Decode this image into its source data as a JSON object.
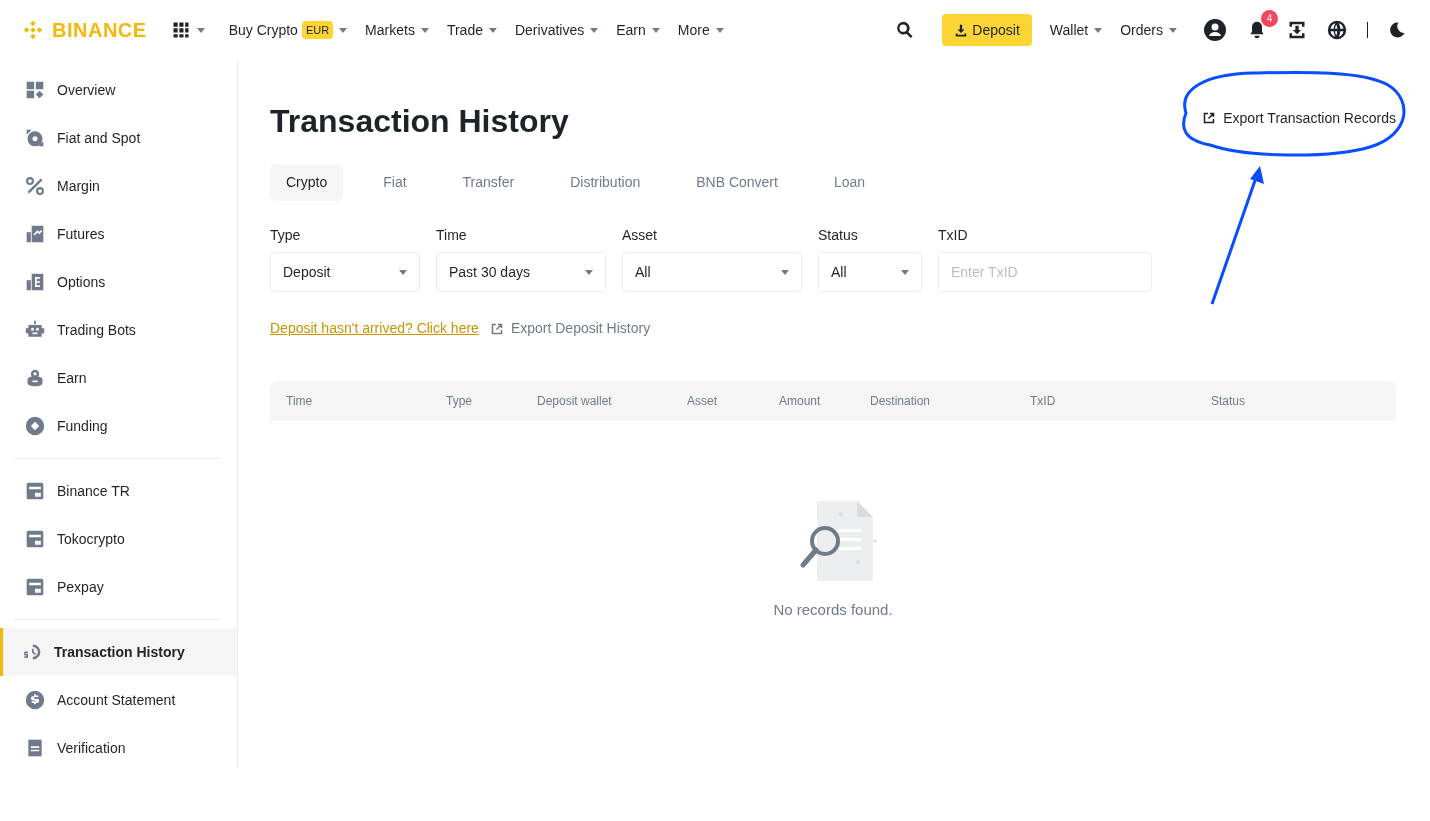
{
  "header": {
    "logo": "BINANCE",
    "nav": [
      {
        "label": "Buy Crypto",
        "badge": "EUR",
        "caret": true
      },
      {
        "label": "Markets",
        "caret": true
      },
      {
        "label": "Trade",
        "caret": true
      },
      {
        "label": "Derivatives",
        "caret": true
      },
      {
        "label": "Earn",
        "caret": true
      },
      {
        "label": "More",
        "caret": true
      }
    ],
    "deposit_button": "Deposit",
    "right_menus": [
      {
        "label": "Wallet",
        "caret": true
      },
      {
        "label": "Orders",
        "caret": true
      }
    ],
    "notification_count": "4"
  },
  "sidebar": {
    "groups": [
      {
        "items": [
          {
            "label": "Overview",
            "selected": false
          },
          {
            "label": "Fiat and Spot",
            "selected": false
          },
          {
            "label": "Margin",
            "selected": false
          },
          {
            "label": "Futures",
            "selected": false
          },
          {
            "label": "Options",
            "selected": false
          },
          {
            "label": "Trading Bots",
            "selected": false
          },
          {
            "label": "Earn",
            "selected": false
          },
          {
            "label": "Funding",
            "selected": false
          }
        ]
      },
      {
        "items": [
          {
            "label": "Binance TR",
            "selected": false
          },
          {
            "label": "Tokocrypto",
            "selected": false
          },
          {
            "label": "Pexpay",
            "selected": false
          }
        ]
      },
      {
        "items": [
          {
            "label": "Transaction History",
            "selected": true
          },
          {
            "label": "Account Statement",
            "selected": false
          },
          {
            "label": "Verification",
            "selected": false
          }
        ]
      }
    ]
  },
  "page": {
    "title": "Transaction History",
    "export_link": "Export Transaction Records",
    "tabs": [
      {
        "label": "Crypto",
        "selected": true
      },
      {
        "label": "Fiat",
        "selected": false
      },
      {
        "label": "Transfer",
        "selected": false
      },
      {
        "label": "Distribution",
        "selected": false
      },
      {
        "label": "BNB Convert",
        "selected": false
      },
      {
        "label": "Loan",
        "selected": false
      }
    ],
    "filters": [
      {
        "kind": "select",
        "label": "Type",
        "value": "Deposit"
      },
      {
        "kind": "select",
        "label": "Time",
        "value": "Past 30 days"
      },
      {
        "kind": "select",
        "label": "Asset",
        "value": "All"
      },
      {
        "kind": "select",
        "label": "Status",
        "value": "All"
      },
      {
        "kind": "input",
        "label": "TxID",
        "placeholder": "Enter TxID"
      }
    ],
    "help_link": "Deposit hasn't arrived? Click here",
    "export_deposit": "Export Deposit History",
    "table": {
      "columns": [
        "Time",
        "Type",
        "Deposit wallet",
        "Asset",
        "Amount",
        "Destination",
        "TxID",
        "Status"
      ]
    },
    "empty_message": "No records found."
  }
}
